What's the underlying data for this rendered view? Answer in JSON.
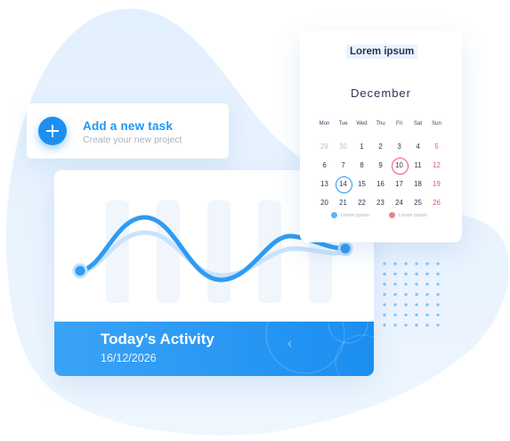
{
  "task": {
    "title": "Add a new task",
    "subtitle": "Create your new project",
    "icon": "plus-icon"
  },
  "activity": {
    "title": "Today’s Activity",
    "date": "16/12/2026"
  },
  "calendar": {
    "header": "Lorem ipsum",
    "month": "December",
    "weekdays": [
      "Mon",
      "Tue",
      "Wed",
      "Thu",
      "Fri",
      "Sat",
      "Sun"
    ],
    "days": [
      {
        "label": "29",
        "style": "muted"
      },
      {
        "label": "30",
        "style": "muted"
      },
      {
        "label": "1",
        "style": ""
      },
      {
        "label": "2",
        "style": ""
      },
      {
        "label": "3",
        "style": ""
      },
      {
        "label": "4",
        "style": ""
      },
      {
        "label": "5",
        "style": "red"
      },
      {
        "label": "6",
        "style": ""
      },
      {
        "label": "7",
        "style": ""
      },
      {
        "label": "8",
        "style": ""
      },
      {
        "label": "9",
        "style": ""
      },
      {
        "label": "10",
        "style": "marked"
      },
      {
        "label": "11",
        "style": ""
      },
      {
        "label": "12",
        "style": "red"
      },
      {
        "label": "13",
        "style": ""
      },
      {
        "label": "14",
        "style": "today"
      },
      {
        "label": "15",
        "style": ""
      },
      {
        "label": "16",
        "style": ""
      },
      {
        "label": "17",
        "style": ""
      },
      {
        "label": "18",
        "style": ""
      },
      {
        "label": "19",
        "style": "red"
      },
      {
        "label": "20",
        "style": ""
      },
      {
        "label": "21",
        "style": ""
      },
      {
        "label": "22",
        "style": ""
      },
      {
        "label": "23",
        "style": ""
      },
      {
        "label": "24",
        "style": ""
      },
      {
        "label": "25",
        "style": ""
      },
      {
        "label": "26",
        "style": "red"
      }
    ],
    "legend": [
      {
        "label": "Lorem ipsum",
        "color": "#5fb4f5"
      },
      {
        "label": "Lorem ipsum",
        "color": "#f07f90"
      }
    ]
  },
  "colors": {
    "accent": "#2196f3",
    "background_blob": "#eaf4fd",
    "weekend": "#e8566c"
  }
}
